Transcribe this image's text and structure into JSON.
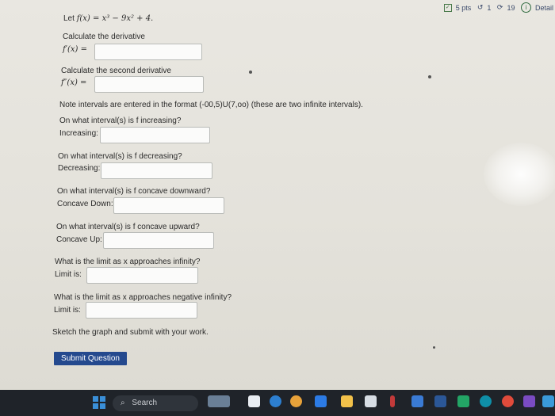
{
  "header": {
    "points": "5 pts",
    "undo_count": "1",
    "retry_count": "19",
    "details_label": "Detail"
  },
  "problem": {
    "statement_prefix": "Let",
    "function_def": "f(x) = x³ − 9x² + 4."
  },
  "questions": {
    "derivative": {
      "prompt": "Calculate the derivative",
      "label": "f′(x) =",
      "value": ""
    },
    "second_derivative": {
      "prompt": "Calculate the second derivative",
      "label": "f″(x) =",
      "value": ""
    },
    "note": "Note intervals are entered in the format (-00,5)U(7,oo) (these are two infinite intervals).",
    "increasing": {
      "prompt": "On what interval(s) is f increasing?",
      "label": "Increasing:",
      "value": ""
    },
    "decreasing": {
      "prompt": "On what interval(s) is f decreasing?",
      "label": "Decreasing:",
      "value": ""
    },
    "concave_down": {
      "prompt": "On what interval(s) is f concave downward?",
      "label": "Concave Down:",
      "value": ""
    },
    "concave_up": {
      "prompt": "On what interval(s) is f concave upward?",
      "label": "Concave Up:",
      "value": ""
    },
    "limit_pos": {
      "prompt": "What is the limit as x approaches infinity?",
      "label": "Limit is:",
      "value": ""
    },
    "limit_neg": {
      "prompt": "What is the limit as x approaches negative infinity?",
      "label": "Limit is:",
      "value": ""
    },
    "sketch": "Sketch the graph and submit with your work."
  },
  "submit_label": "Submit Question",
  "taskbar": {
    "search_placeholder": "Search"
  },
  "colors": {
    "submit_button": "#24498e",
    "taskbar": "#1f2329",
    "page_background": "#e6e4de"
  }
}
